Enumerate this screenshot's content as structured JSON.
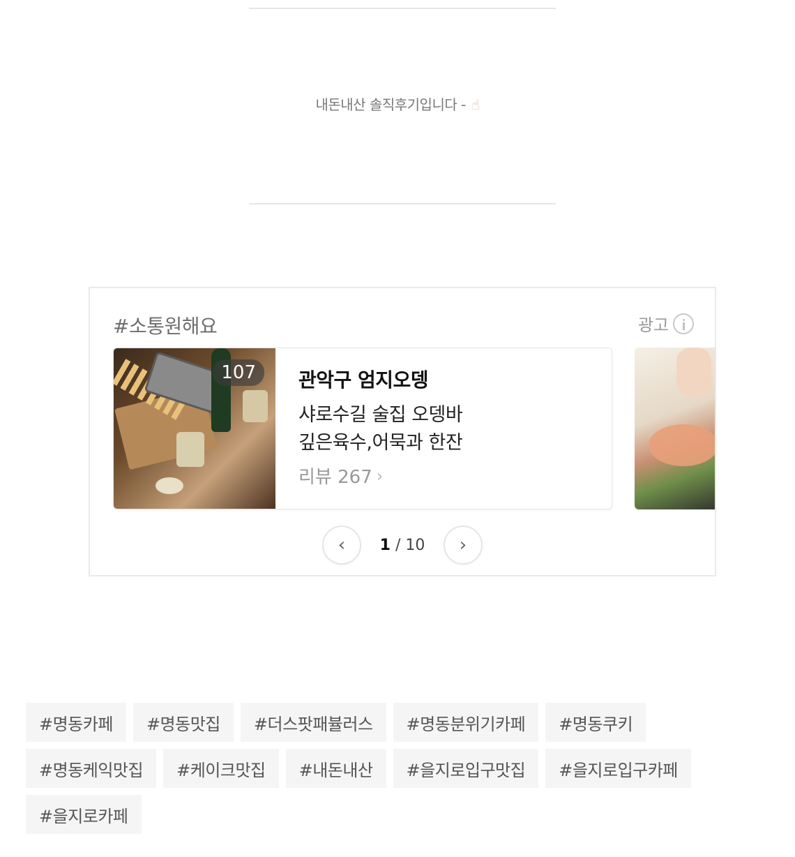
{
  "quote": {
    "text": "내돈내산 솔직후기입니다 -",
    "emoji": "☝"
  },
  "ad": {
    "section_title": "#소통원해요",
    "ad_label": "광고",
    "card": {
      "badge": "107",
      "title": "관악구 엄지오뎅",
      "desc_line1": "샤로수길 술집 오뎅바",
      "desc_line2": "깊은육수,어묵과 한잔",
      "review_label": "리뷰 267"
    },
    "pager": {
      "current": "1",
      "total": "/ 10",
      "prev": "‹",
      "next": "›"
    }
  },
  "tags": [
    "#명동카페",
    "#명동맛집",
    "#더스팟패뷸러스",
    "#명동분위기카페",
    "#명동쿠키",
    "#명동케익맛집",
    "#케이크맛집",
    "#내돈내산",
    "#을지로입구맛집",
    "#을지로입구카페",
    "#을지로카페"
  ]
}
